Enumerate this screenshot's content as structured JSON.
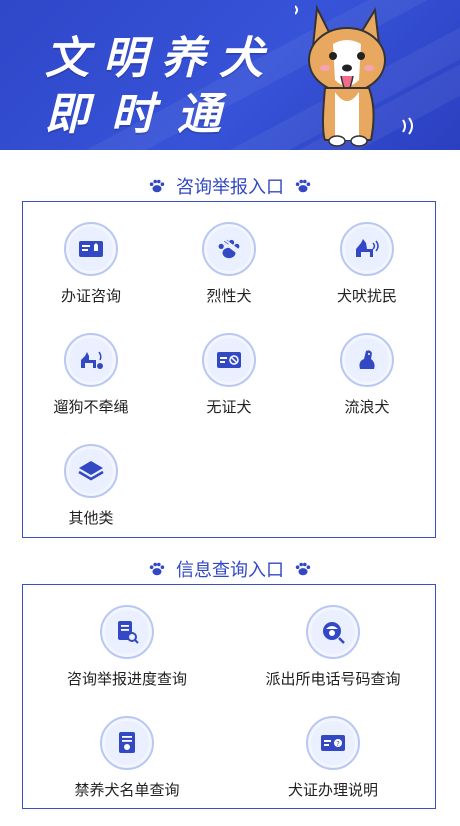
{
  "banner": {
    "title_line1": "文明养犬",
    "title_line2": "即时通"
  },
  "section1": {
    "title": "咨询举报入口",
    "items": [
      {
        "label": "办证咨询",
        "icon": "id-card-dog-icon"
      },
      {
        "label": "烈性犬",
        "icon": "aggressive-paw-icon"
      },
      {
        "label": "犬吠扰民",
        "icon": "barking-dog-icon"
      },
      {
        "label": "遛狗不牵绳",
        "icon": "unleashed-dog-icon"
      },
      {
        "label": "无证犬",
        "icon": "no-license-card-icon"
      },
      {
        "label": "流浪犬",
        "icon": "stray-dog-icon"
      },
      {
        "label": "其他类",
        "icon": "layers-icon"
      }
    ]
  },
  "section2": {
    "title": "信息查询入口",
    "items": [
      {
        "label": "咨询举报进度查询",
        "icon": "document-search-icon"
      },
      {
        "label": "派出所电话号码查询",
        "icon": "police-search-icon"
      },
      {
        "label": "禁养犬名单查询",
        "icon": "banned-dog-list-icon"
      },
      {
        "label": "犬证办理说明",
        "icon": "license-info-icon"
      }
    ]
  },
  "colors": {
    "brand": "#3349c4",
    "banner_bg": "#2f47c9",
    "icon_bg": "#eaf0ff"
  }
}
